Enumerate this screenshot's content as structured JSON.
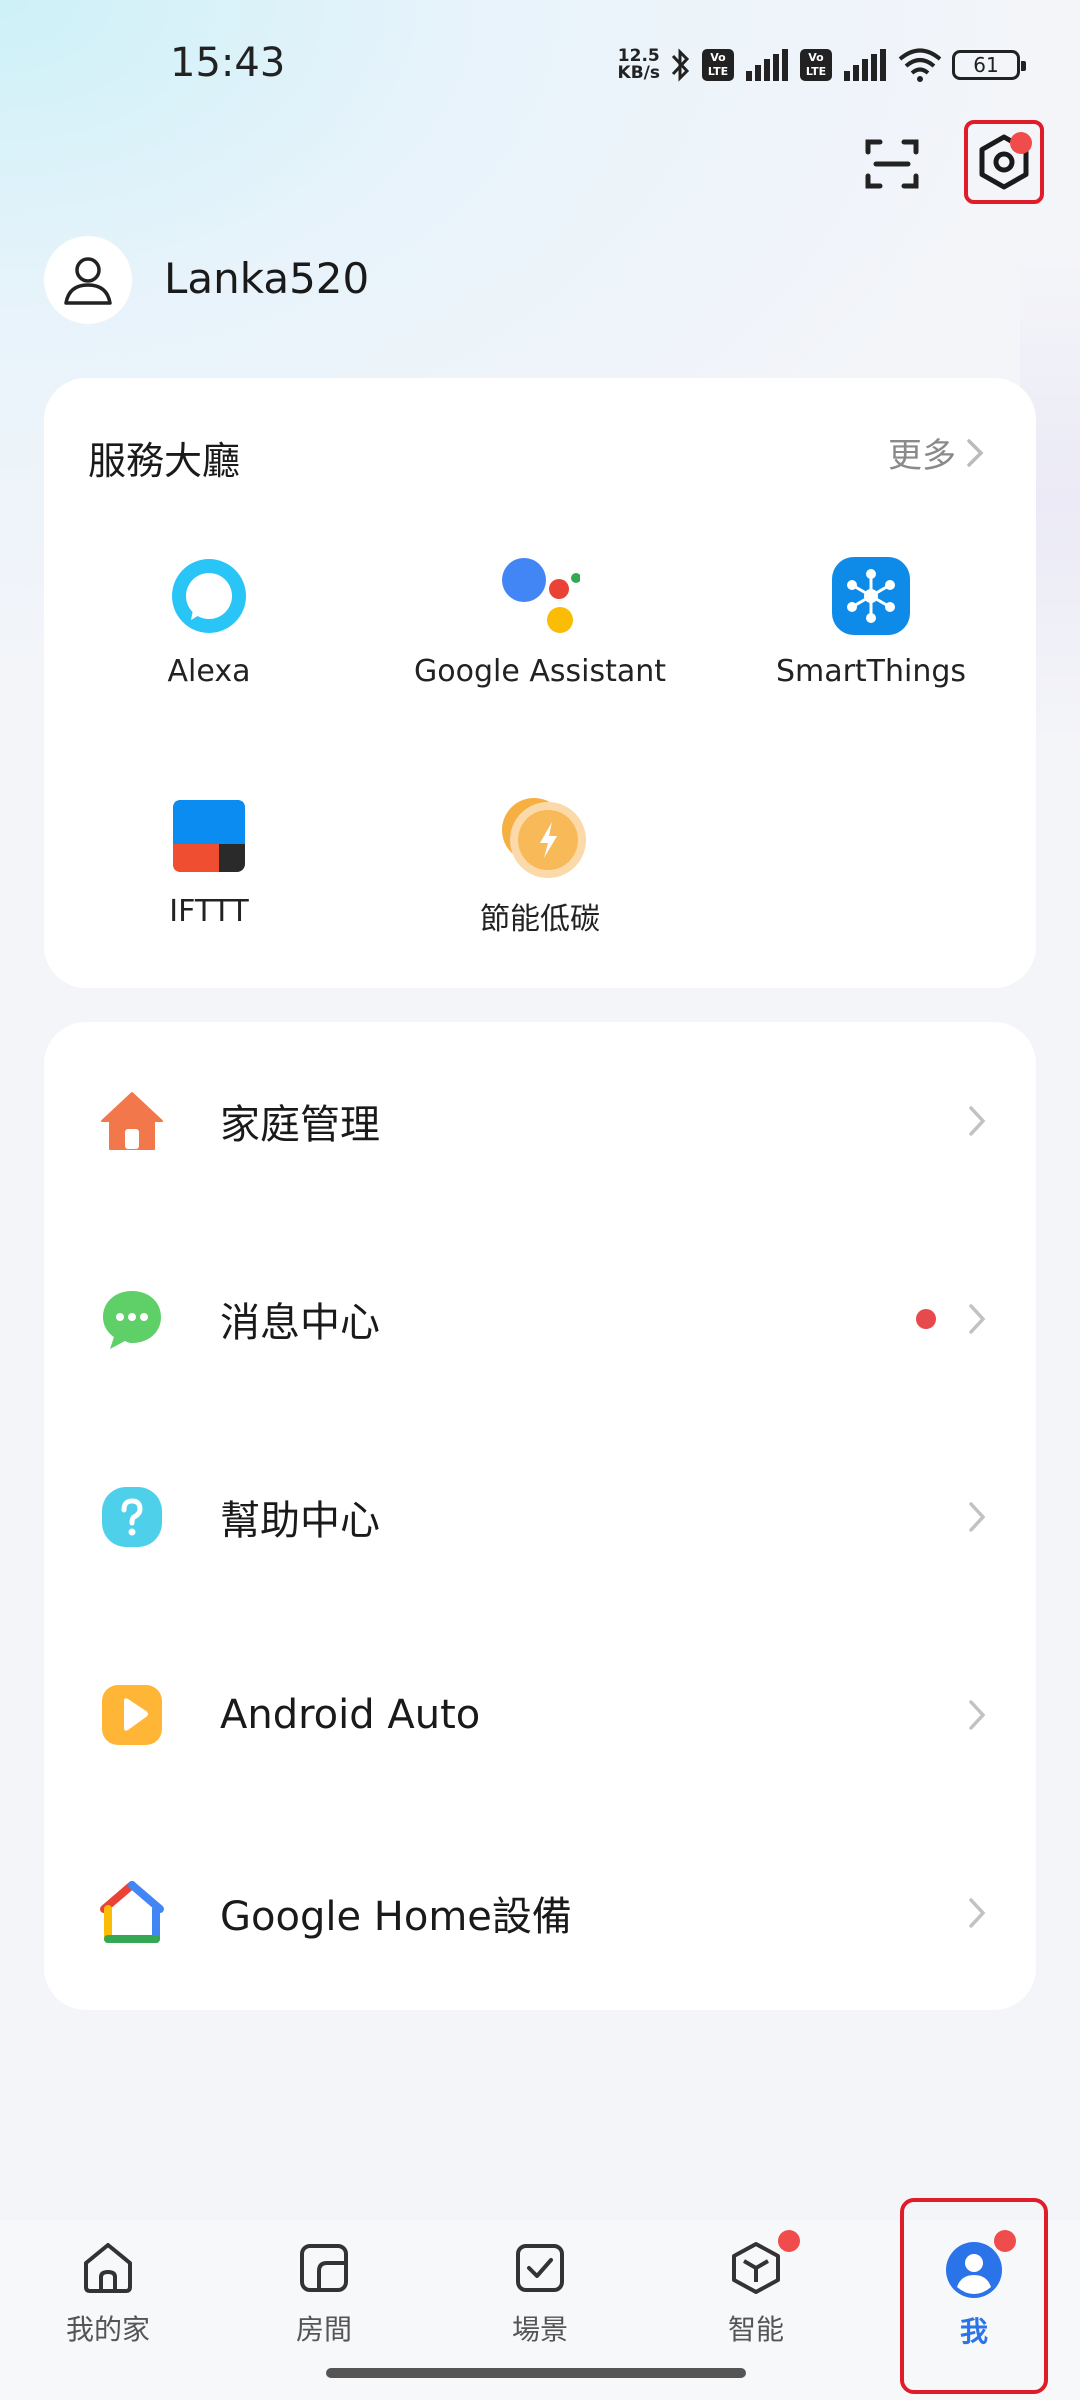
{
  "status_bar": {
    "time": "15:43",
    "net_speed_value": "12.5",
    "net_speed_unit": "KB/s",
    "volte_label": "Vo LTE",
    "battery": "61"
  },
  "user": {
    "name": "Lanka520"
  },
  "services": {
    "title": "服務大廳",
    "more_label": "更多",
    "items": [
      {
        "label": "Alexa",
        "icon": "alexa-icon"
      },
      {
        "label": "Google Assistant",
        "icon": "google-assistant-icon"
      },
      {
        "label": "SmartThings",
        "icon": "smartthings-icon"
      },
      {
        "label": "IFTTT",
        "icon": "ifttt-icon"
      },
      {
        "label": "節能低碳",
        "icon": "energy-saving-icon"
      }
    ]
  },
  "menu": {
    "items": [
      {
        "label": "家庭管理",
        "icon": "home-management-icon",
        "color": "#f2784b"
      },
      {
        "label": "消息中心",
        "icon": "message-icon",
        "color": "#5fd068",
        "has_badge": true
      },
      {
        "label": "幫助中心",
        "icon": "help-icon",
        "color": "#4fd0ea"
      },
      {
        "label": "Android Auto",
        "icon": "android-auto-icon",
        "color": "#ffb637"
      },
      {
        "label": "Google Home設備",
        "icon": "google-home-icon"
      }
    ]
  },
  "bottom_nav": {
    "items": [
      {
        "label": "我的家",
        "icon": "home-icon"
      },
      {
        "label": "房間",
        "icon": "room-icon"
      },
      {
        "label": "場景",
        "icon": "scene-icon"
      },
      {
        "label": "智能",
        "icon": "smart-icon",
        "has_badge": true
      },
      {
        "label": "我",
        "icon": "profile-icon",
        "active": true,
        "has_badge": true
      }
    ]
  },
  "colors": {
    "accent": "#2a73e8",
    "badge": "#f14c4c",
    "highlight_box": "#e01c2a"
  }
}
